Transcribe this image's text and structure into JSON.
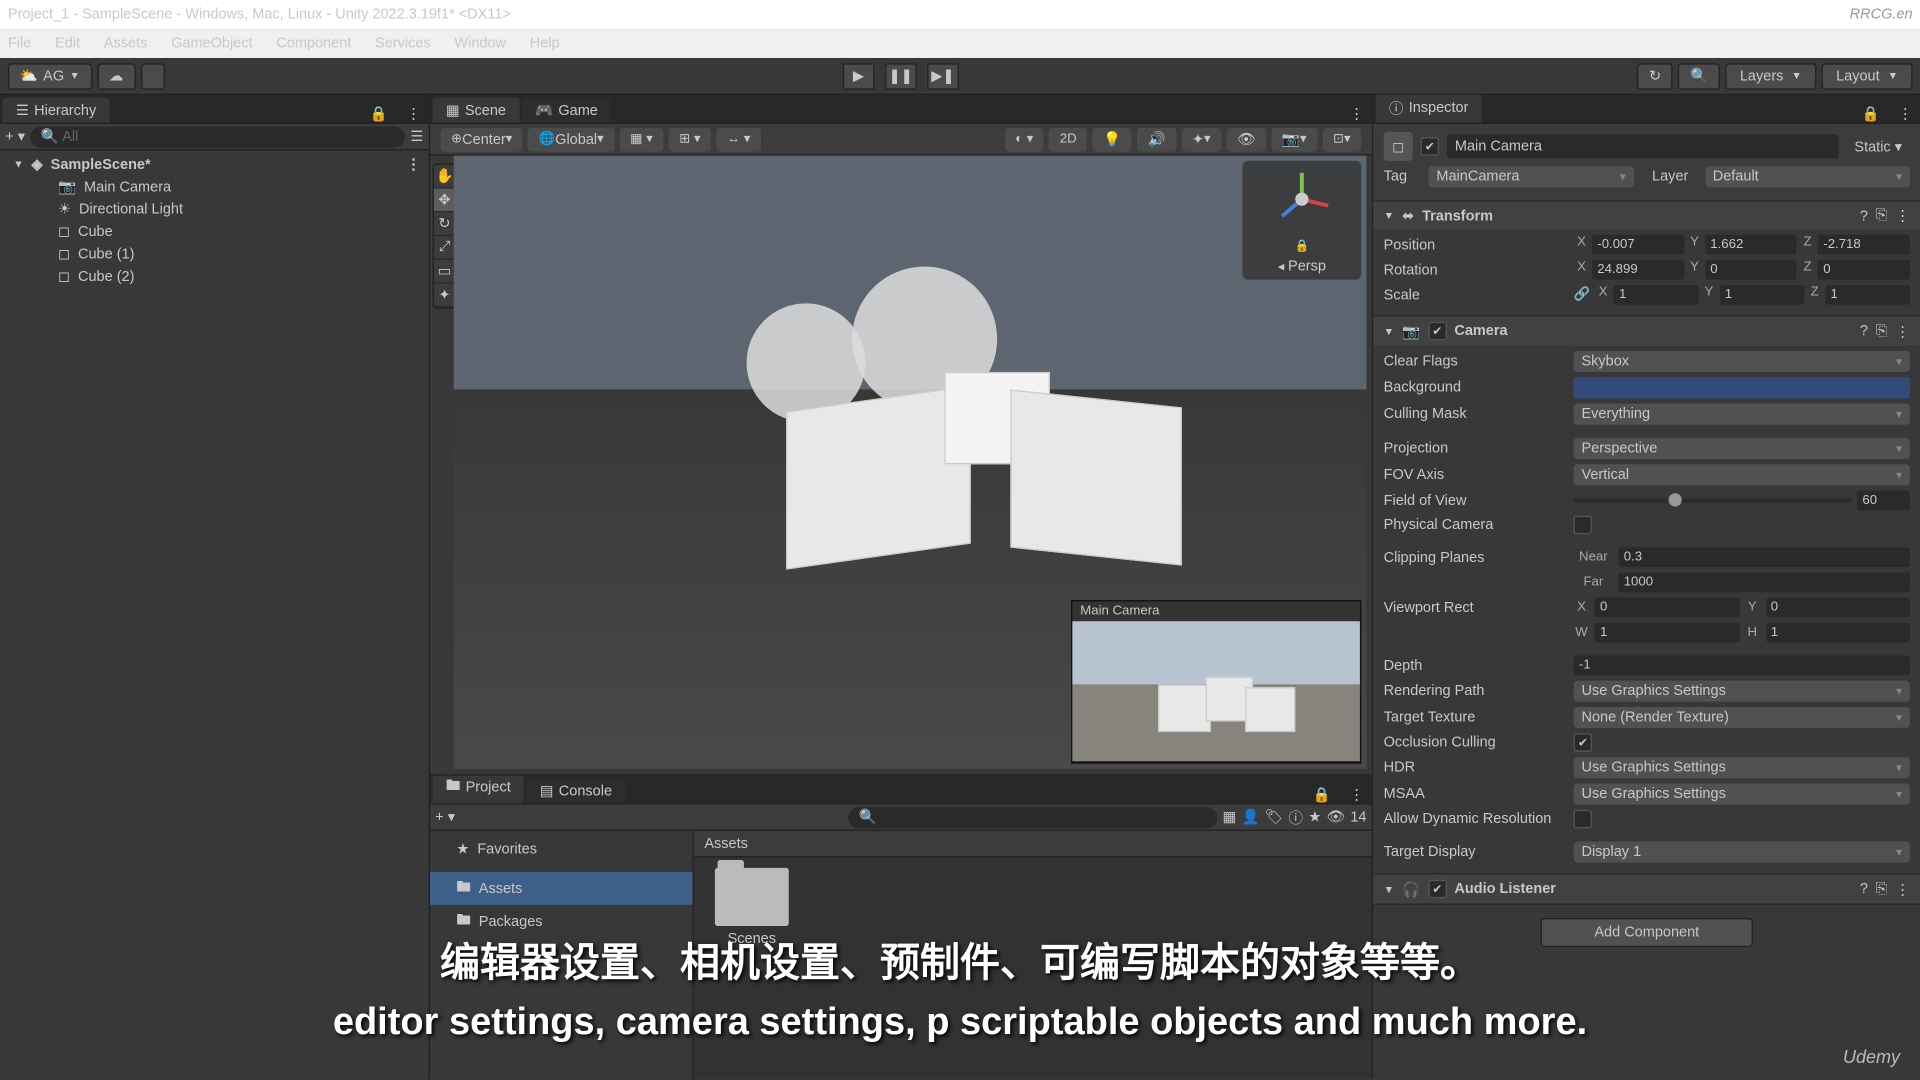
{
  "window": {
    "title": "Project_1 - SampleScene - Windows, Mac, Linux - Unity 2022.3.19f1* <DX11>",
    "watermark_tr": "RRCG.en"
  },
  "menu": {
    "items": [
      "File",
      "Edit",
      "Assets",
      "GameObject",
      "Component",
      "Services",
      "Window",
      "Help"
    ]
  },
  "toolbar": {
    "account": "AG",
    "layers": "Layers",
    "layout": "Layout"
  },
  "hierarchy": {
    "tab": "Hierarchy",
    "search_placeholder": "All",
    "scene": "SampleScene*",
    "items": [
      "Main Camera",
      "Directional Light",
      "Cube",
      "Cube (1)",
      "Cube (2)"
    ]
  },
  "scene": {
    "tab_scene": "Scene",
    "tab_game": "Game",
    "pivot": "Center",
    "space": "Global",
    "mode2d": "2D",
    "gizmo_persp": "Persp",
    "preview_title": "Main Camera"
  },
  "project": {
    "tab_project": "Project",
    "tab_console": "Console",
    "favorites": "Favorites",
    "folders": [
      "Assets",
      "Packages"
    ],
    "breadcrumb": "Assets",
    "assets": [
      "Scenes"
    ],
    "count": "14"
  },
  "inspector": {
    "tab": "Inspector",
    "name": "Main Camera",
    "static": "Static",
    "tag_label": "Tag",
    "tag_value": "MainCamera",
    "layer_label": "Layer",
    "layer_value": "Default",
    "transform": {
      "title": "Transform",
      "position_label": "Position",
      "pos": {
        "x": "-0.007",
        "y": "1.662",
        "z": "-2.718"
      },
      "rotation_label": "Rotation",
      "rot": {
        "x": "24.899",
        "y": "0",
        "z": "0"
      },
      "scale_label": "Scale",
      "scl": {
        "x": "1",
        "y": "1",
        "z": "1"
      }
    },
    "camera": {
      "title": "Camera",
      "clear_flags_label": "Clear Flags",
      "clear_flags": "Skybox",
      "background_label": "Background",
      "culling_mask_label": "Culling Mask",
      "culling_mask": "Everything",
      "projection_label": "Projection",
      "projection": "Perspective",
      "fov_axis_label": "FOV Axis",
      "fov_axis": "Vertical",
      "fov_label": "Field of View",
      "fov": "60",
      "physical_label": "Physical Camera",
      "clipping_label": "Clipping Planes",
      "near_label": "Near",
      "near": "0.3",
      "far_label": "Far",
      "far": "1000",
      "viewport_label": "Viewport Rect",
      "vp": {
        "x": "0",
        "y": "0",
        "w": "1",
        "h": "1"
      },
      "depth_label": "Depth",
      "depth": "-1",
      "rendering_label": "Rendering Path",
      "rendering": "Use Graphics Settings",
      "target_tex_label": "Target Texture",
      "target_tex": "None (Render Texture)",
      "occlusion_label": "Occlusion Culling",
      "hdr_label": "HDR",
      "hdr": "Use Graphics Settings",
      "msaa_label": "MSAA",
      "msaa": "Use Graphics Settings",
      "dynres_label": "Allow Dynamic Resolution",
      "target_display_label": "Target Display",
      "target_display": "Display 1"
    },
    "audio": {
      "title": "Audio Listener"
    },
    "add_component": "Add Component"
  },
  "subtitles": {
    "cn": "编辑器设置、相机设置、预制件、可编写脚本的对象等等。",
    "en": "editor settings, camera settings, p                scriptable objects and much more."
  },
  "brand": "Udemy"
}
